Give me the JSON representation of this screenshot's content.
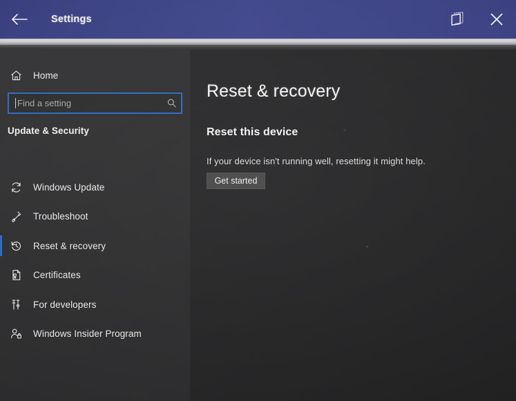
{
  "window": {
    "title": "Settings",
    "titlebar_color": "#3e4484",
    "accent_color": "#2f6cc4",
    "back_icon": "back-arrow-icon",
    "restore_icon": "restore-window-icon",
    "close_icon": "close-icon"
  },
  "sidebar": {
    "home": {
      "label": "Home",
      "icon": "home-icon"
    },
    "search": {
      "placeholder": "Find a setting",
      "value": "",
      "icon": "search-icon"
    },
    "group_title": "Update & Security",
    "items": [
      {
        "label": "Windows Update",
        "icon": "sync-icon",
        "selected": false
      },
      {
        "label": "Troubleshoot",
        "icon": "wrench-icon",
        "selected": false
      },
      {
        "label": "Reset & recovery",
        "icon": "history-icon",
        "selected": true
      },
      {
        "label": "Certificates",
        "icon": "certificate-icon",
        "selected": false
      },
      {
        "label": "For developers",
        "icon": "developer-tools-icon",
        "selected": false
      },
      {
        "label": "Windows Insider Program",
        "icon": "person-insider-icon",
        "selected": false
      }
    ]
  },
  "main": {
    "page_title": "Reset & recovery",
    "section_title": "Reset this device",
    "section_description": "If your device isn't running well, resetting it might help.",
    "button_label": "Get started"
  }
}
